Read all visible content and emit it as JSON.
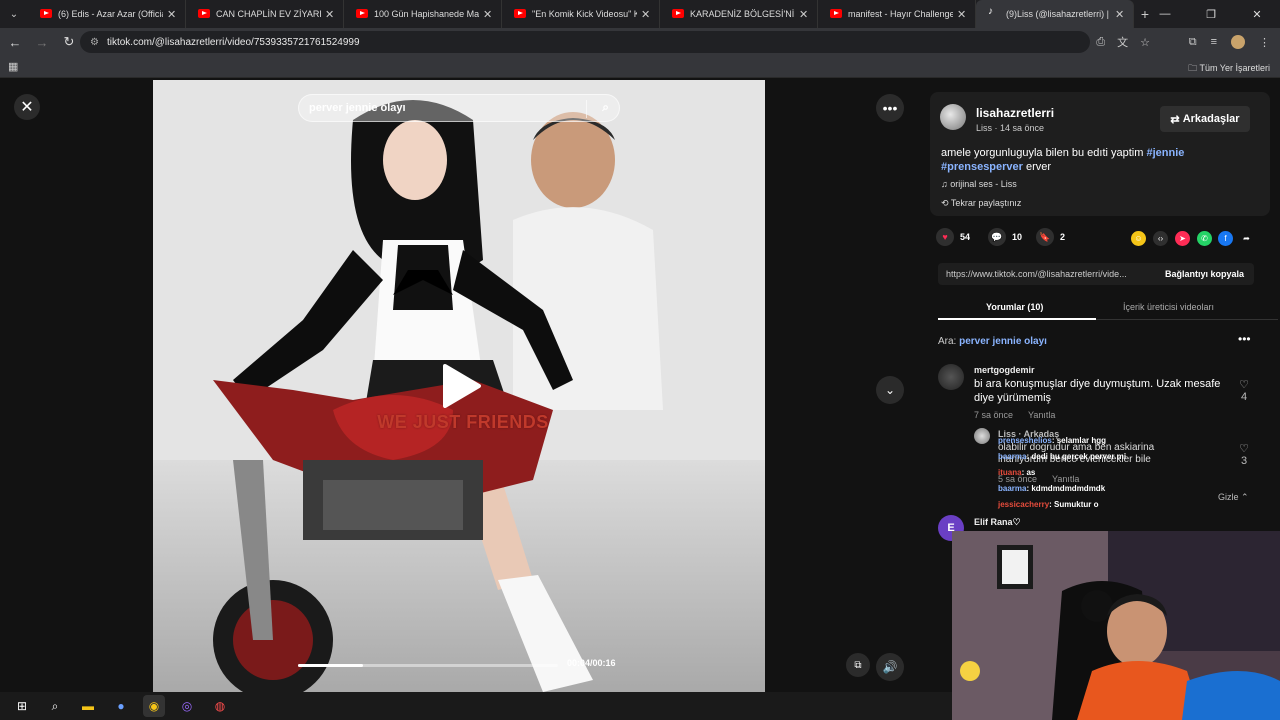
{
  "tabs": [
    {
      "title": "(6) Edis - Azar Azar (Official Vid",
      "type": "yt"
    },
    {
      "title": "CAN CHAPLİN EV ZİYARETİ - Yo",
      "type": "yt"
    },
    {
      "title": "100 Gün Hapishanede Mahsur",
      "type": "yt"
    },
    {
      "title": "\"En Komik Kick Videosu\" Kick C",
      "type": "yt"
    },
    {
      "title": "KARADENİZ BÖLGESİ'NİN EN D",
      "type": "yt"
    },
    {
      "title": "manifest - Hayır Challenge | Re",
      "type": "yt"
    },
    {
      "title": "(9)Liss (@lisahazretlerri) | TikTo",
      "type": "tt"
    }
  ],
  "browser": {
    "url": "tiktok.com/@lisahazretlerri/video/7539335721761524999",
    "all_bookmarks": "Tüm Yer İşaretleri"
  },
  "video": {
    "search_placeholder": "perver jennie olayı",
    "overlay_text": "WE JUST FRIENDS",
    "timecode": "00:04/00:16",
    "progress": 0.25
  },
  "post": {
    "author": "lisahazretlerri",
    "meta": "Liss · 14 sa önce",
    "friends_label": "Arkadaşlar",
    "caption_text": "amele yorgunluguyla bilen bu edıti yaptim ",
    "hashtag1": "#jennie",
    "hashtag2": "#prensesperver",
    "caption_end": " erver",
    "music": "orijinal ses - Liss",
    "repost": "Tekrar paylaştınız",
    "likes": "54",
    "comments": "10",
    "saves": "2",
    "link_url": "https://www.tiktok.com/@lisahazretlerri/vide...",
    "copy_label": "Bağlantıyı kopyala"
  },
  "panel_tabs": {
    "comments": "Yorumlar (10)",
    "creator": "İçerik üreticisi videoları"
  },
  "search_hint": {
    "prefix": "Ara: ",
    "query": "perver jennie olayı"
  },
  "comments": [
    {
      "user": "mertgogdemir",
      "text": "bi ara konuşmuşlar diye duymuştum. Uzak mesafe diye yürümemiş",
      "time": "7 sa önce",
      "reply": "Yanıtla",
      "likes": "4"
    },
    {
      "user": "Liss · Arkadaş",
      "text": "olabilir dogrudur ama ben askiarina inaniyorum bence evlenicekler bile",
      "time": "5 sa önce",
      "reply": "Yanıtla",
      "likes": "3"
    },
    {
      "user": "Elif Rana♡"
    }
  ],
  "hide_label": "Gizle",
  "chat": [
    {
      "name": "prenseshelios",
      "msg": ": selamlar hgg"
    },
    {
      "name": "baarma",
      "msg": ": dedi bu gerçek perver mi"
    },
    {
      "name": "ituana",
      "msg": ": as"
    },
    {
      "name": "baarma",
      "msg": ": kdmdmdmdmdmdk"
    },
    {
      "name": "jessicacherry",
      "msg": ": Sumuktur o"
    }
  ],
  "colors": {
    "accent_link": "#8ab4ff",
    "like_red": "#fe2c55",
    "overlay_red": "#c0392b"
  }
}
